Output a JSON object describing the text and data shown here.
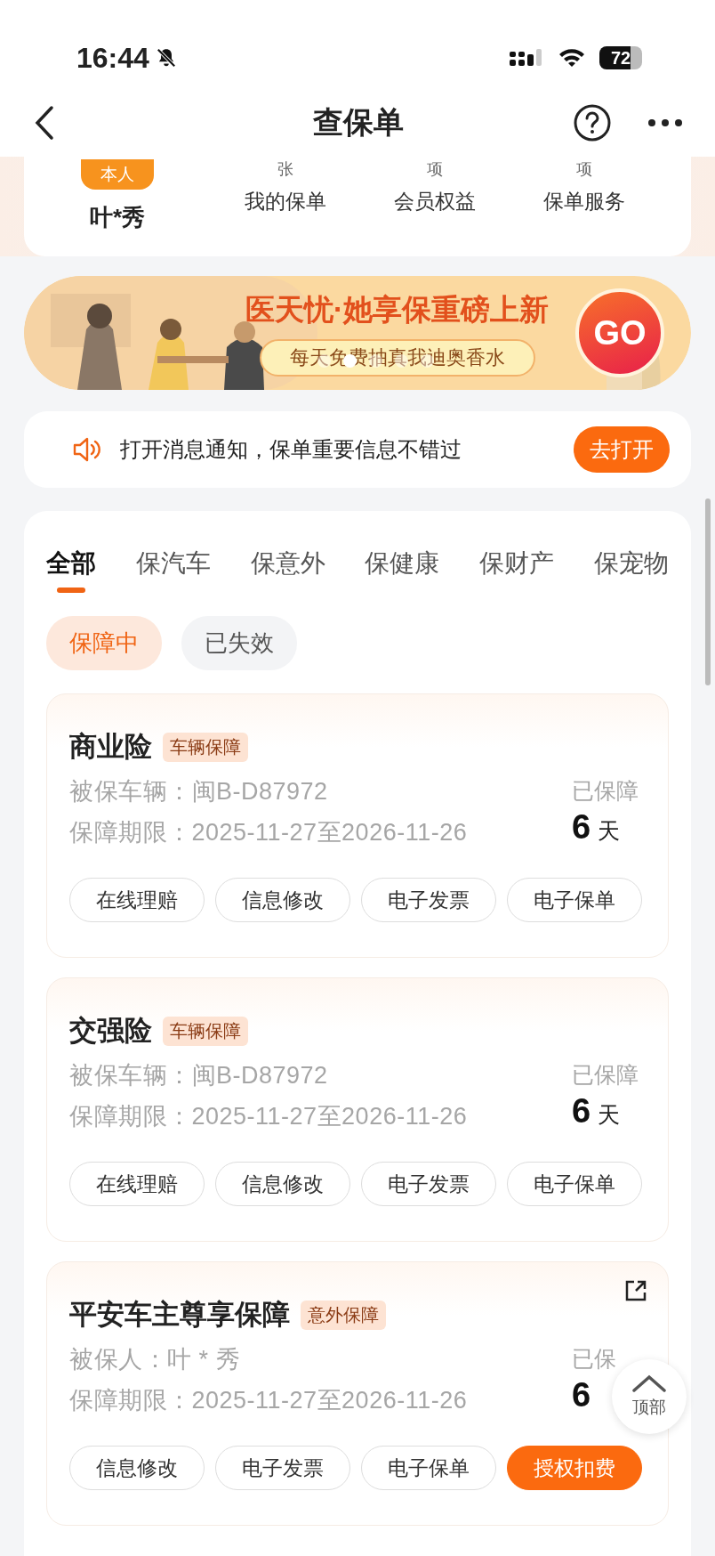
{
  "status_bar": {
    "time": "16:44",
    "battery": "72"
  },
  "nav": {
    "title": "查保单"
  },
  "profile": {
    "badge": "本人",
    "name": "叶*秀",
    "stats": [
      {
        "unit": "张",
        "label": "我的保单"
      },
      {
        "unit": "项",
        "label": "会员权益"
      },
      {
        "unit": "项",
        "label": "保单服务"
      }
    ]
  },
  "banner": {
    "title": "医天忧·她享保重磅上新",
    "subtitle": "每天免费抽真我迪奥香水",
    "button": "GO",
    "dots": [
      {
        "selected": false
      },
      {
        "selected": true
      },
      {
        "selected": false
      },
      {
        "selected": false
      },
      {
        "selected": false
      }
    ]
  },
  "notice": {
    "text": "打开消息通知，保单重要信息不错过",
    "button": "去打开"
  },
  "tabs": [
    {
      "label": "全部",
      "selected": true
    },
    {
      "label": "保汽车",
      "selected": false
    },
    {
      "label": "保意外",
      "selected": false
    },
    {
      "label": "保健康",
      "selected": false
    },
    {
      "label": "保财产",
      "selected": false
    },
    {
      "label": "保宠物",
      "selected": false
    }
  ],
  "filters": [
    {
      "label": "保障中",
      "selected": true
    },
    {
      "label": "已失效",
      "selected": false
    }
  ],
  "policies": [
    {
      "title": "商业险",
      "tag": "车辆保障",
      "external_link": false,
      "fields": [
        {
          "label": "被保车辆：",
          "value": "闽B-D87972"
        },
        {
          "label": "保障期限：",
          "value": "2025-11-27至2026-11-26"
        }
      ],
      "status": "已保障",
      "days": "6",
      "unit": "天",
      "actions": [
        {
          "label": "在线理赔",
          "primary": false
        },
        {
          "label": "信息修改",
          "primary": false
        },
        {
          "label": "电子发票",
          "primary": false
        },
        {
          "label": "电子保单",
          "primary": false
        }
      ]
    },
    {
      "title": "交强险",
      "tag": "车辆保障",
      "external_link": false,
      "fields": [
        {
          "label": "被保车辆：",
          "value": "闽B-D87972"
        },
        {
          "label": "保障期限：",
          "value": "2025-11-27至2026-11-26"
        }
      ],
      "status": "已保障",
      "days": "6",
      "unit": "天",
      "actions": [
        {
          "label": "在线理赔",
          "primary": false
        },
        {
          "label": "信息修改",
          "primary": false
        },
        {
          "label": "电子发票",
          "primary": false
        },
        {
          "label": "电子保单",
          "primary": false
        }
      ]
    },
    {
      "title": "平安车主尊享保障",
      "tag": "意外保障",
      "external_link": true,
      "fields": [
        {
          "label": "被保人：",
          "value": "叶 * 秀"
        },
        {
          "label": "保障期限：",
          "value": "2025-11-27至2026-11-26"
        }
      ],
      "status": "已保",
      "days": "6",
      "actions": [
        {
          "label": "信息修改",
          "primary": false
        },
        {
          "label": "电子发票",
          "primary": false
        },
        {
          "label": "电子保单",
          "primary": false
        },
        {
          "label": "授权扣费",
          "primary": true
        }
      ]
    }
  ],
  "back_to_top": "顶部"
}
